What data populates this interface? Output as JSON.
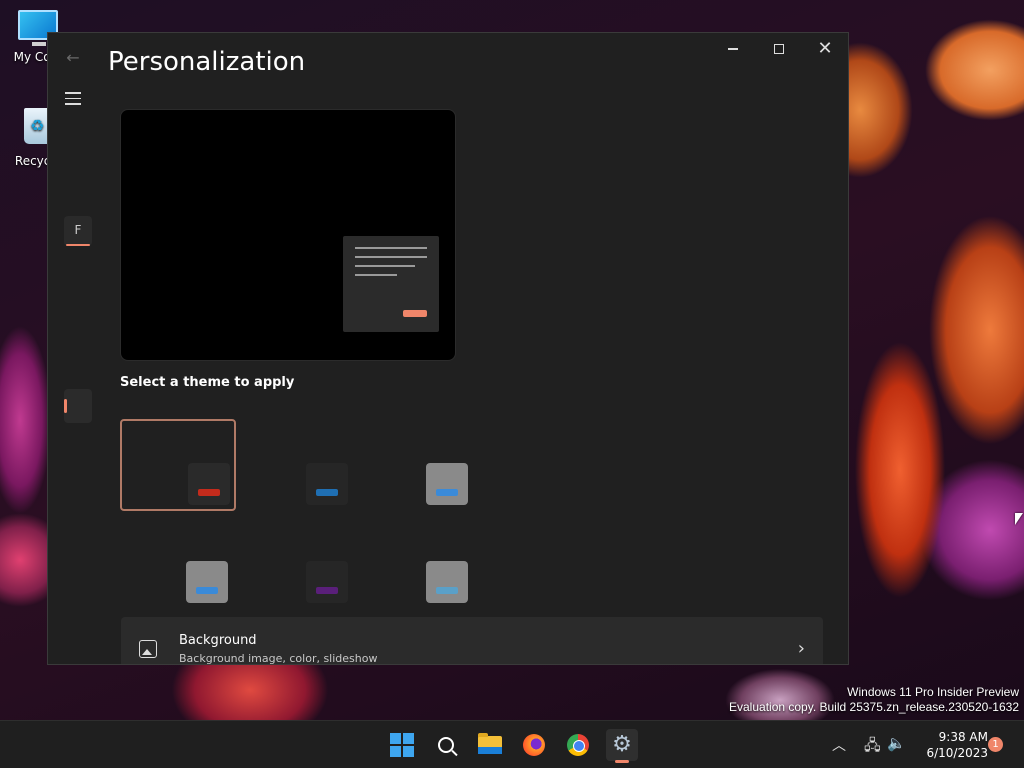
{
  "desktop": {
    "icons": [
      {
        "label": "My Com",
        "icon": "computer-icon"
      },
      {
        "label": "Recycle",
        "icon": "recycle-bin-icon"
      }
    ],
    "watermark_line1": "Windows 11 Pro Insider Preview",
    "watermark_line2": "Evaluation copy. Build 25375.zn_release.230520-1632"
  },
  "window": {
    "title": "Personalization",
    "nav_chip_letter": "F",
    "caption": {
      "minimize": "minimize-icon",
      "maximize": "maximize-icon",
      "close": "close-icon"
    }
  },
  "themes_section": {
    "label": "Select a theme to apply",
    "themes": [
      {
        "tile": "#2a2a2a",
        "accent": "#c42b1c",
        "selected": true
      },
      {
        "tile": "#262626",
        "accent": "#1f6fb3",
        "selected": false
      },
      {
        "tile": "#8a8a8a",
        "accent": "#3a8ad8",
        "selected": false
      },
      {
        "tile": "#8a8a8a",
        "accent": "#3a8ad8",
        "selected": false
      },
      {
        "tile": "#262626",
        "accent": "#5a1f7a",
        "selected": false
      },
      {
        "tile": "#8a8a8a",
        "accent": "#5aa0c8",
        "selected": false
      }
    ]
  },
  "background_card": {
    "title": "Background",
    "subtitle": "Background image, color, slideshow"
  },
  "taskbar": {
    "time": "9:38 AM",
    "date": "6/10/2023",
    "notifications": "1",
    "accent": "#f0866a"
  }
}
